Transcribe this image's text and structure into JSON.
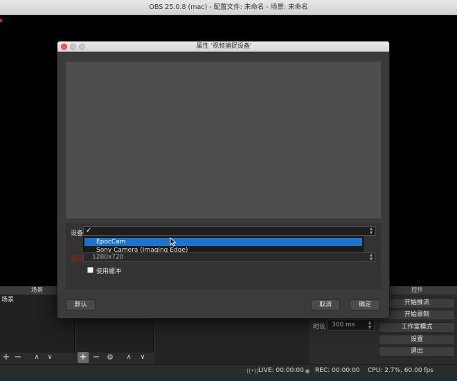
{
  "main_window": {
    "title": "OBS 25.0.8 (mac) - 配置文件: 未命名 - 场景: 未命名"
  },
  "docks": {
    "scenes_title": "场景",
    "scene_item": "场景",
    "controls_title": "控件",
    "controls": [
      "开始推流",
      "开始录制",
      "工作室模式",
      "设置",
      "退出"
    ]
  },
  "transition": {
    "duration_label": "时长",
    "duration_value": "300 ms"
  },
  "toolbar_glyphs": {
    "add": "+",
    "remove": "−",
    "up": "∧",
    "down": "∨",
    "gear": "⚙"
  },
  "statusbar": {
    "live": "LIVE: 00:00:00",
    "rec": "REC: 00:00:00",
    "cpu": "CPU: 2.7%, 60.00 fps"
  },
  "dialog": {
    "title": "属性 '视频捕捉设备'",
    "device_label": "设备",
    "device_value_checkmark": "✓",
    "device_options": [
      "EpocCam",
      "Sony Camera (Imaging Edge)"
    ],
    "selected_option": "EpocCam",
    "preset_label": "预设",
    "preset_value": "1280x720",
    "use_buffering_label": "使用缓冲",
    "use_buffering_checked": false,
    "defaults_button": "默认",
    "cancel_button": "取消",
    "ok_button": "确定"
  },
  "colors": {
    "selection": "#1f72c9",
    "preset_label_red": "#b01515",
    "traffic_red": "#ee5d55",
    "traffic_gray": "#c9c9c9"
  }
}
